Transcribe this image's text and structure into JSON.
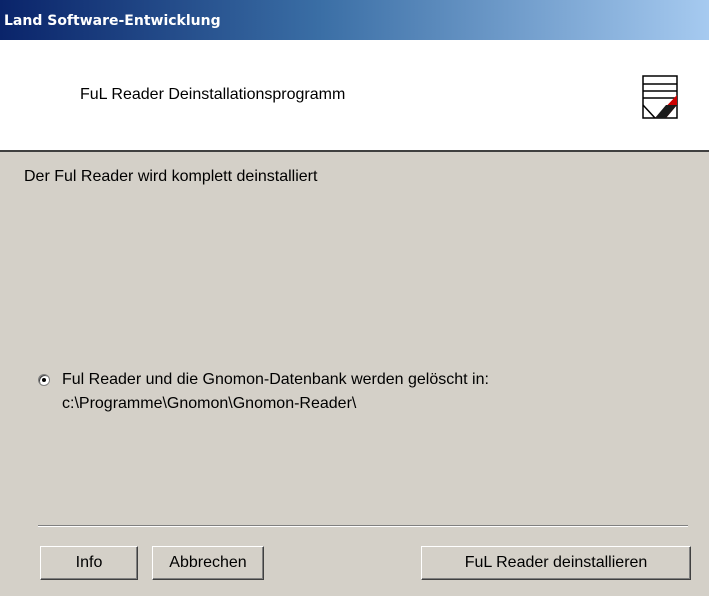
{
  "window": {
    "title": "Land Software-Entwicklung"
  },
  "header": {
    "title": "FuL Reader Deinstallationsprogramm",
    "logo_icon": "ful-reader-logo-icon"
  },
  "main": {
    "description": "Der Ful Reader wird komplett deinstalliert",
    "option": {
      "selected": true,
      "label_line1": "Ful Reader und die Gnomon-Datenbank werden gelöscht in:",
      "label_line2": "c:\\Programme\\Gnomon\\Gnomon-Reader\\"
    }
  },
  "buttons": {
    "info_label": "Info",
    "cancel_label": "Abbrechen",
    "uninstall_label": "FuL Reader deinstallieren"
  },
  "colors": {
    "titlebar_start": "#0a246a",
    "titlebar_end": "#a6caf0",
    "dialog_background": "#d4d0c8",
    "logo_accent": "#cc0000"
  }
}
